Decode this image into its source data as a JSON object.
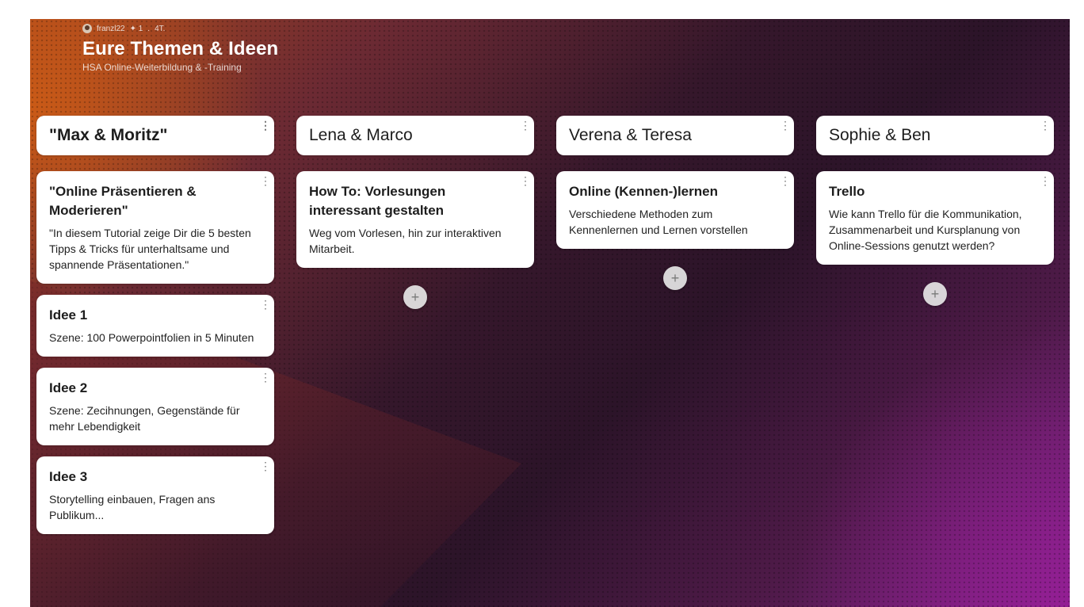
{
  "header": {
    "user": "franzl22",
    "meta_likes": "✦ 1",
    "meta_time": "4T.",
    "title": "Eure Themen & Ideen",
    "subtitle": "HSA Online-Weiterbildung & -Training"
  },
  "columns": [
    {
      "name": "\"Max & Moritz\"",
      "cards": [
        {
          "title": "\"Online Präsentieren & Moderieren\"",
          "body": "\"In diesem Tutorial zeige Dir die 5 besten Tipps & Tricks für unterhaltsame und spannende Präsentationen.\""
        },
        {
          "title": "Idee 1",
          "body": "Szene: 100 Powerpointfolien in 5 Minuten"
        },
        {
          "title": "Idee 2",
          "body": "Szene: Zecihnungen, Gegenstände für mehr Lebendigkeit"
        },
        {
          "title": "Idee 3",
          "body": "Storytelling einbauen, Fragen ans Publikum..."
        }
      ]
    },
    {
      "name": "Lena & Marco",
      "cards": [
        {
          "title": "How To: Vorlesungen interessant gestalten",
          "body": "Weg vom Vorlesen, hin zur interaktiven Mitarbeit."
        }
      ]
    },
    {
      "name": "Verena & Teresa",
      "cards": [
        {
          "title": "Online (Kennen-)lernen",
          "body": "Verschiedene Methoden zum Kennenlernen und Lernen vorstellen"
        }
      ]
    },
    {
      "name": "Sophie & Ben",
      "cards": [
        {
          "title": "Trello",
          "body": "Wie kann Trello für die Kommunikation, Zusammenarbeit und Kursplanung von Online-Sessions genutzt werden?"
        }
      ]
    }
  ],
  "add_label": "+"
}
